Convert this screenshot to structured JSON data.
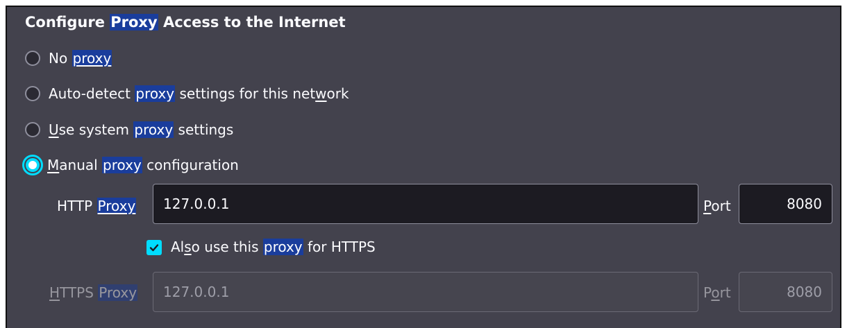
{
  "section": {
    "title_pre": "Configure ",
    "title_hl": "Proxy",
    "title_post": " Access to the Internet"
  },
  "options": [
    {
      "pre": "No ",
      "hl": "proxy",
      "post": ""
    },
    {
      "pre": "Auto-detect ",
      "hl": "proxy",
      "post": " settings for this net",
      "u": "w",
      "post2": "ork"
    },
    {
      "u": "U",
      "pre": "se system ",
      "hl": "proxy",
      "post": " settings"
    },
    {
      "u": "M",
      "pre": "anual ",
      "hl": "proxy",
      "post": " configuration"
    }
  ],
  "http": {
    "label_pre": "HTTP ",
    "label_hl": "Proxy",
    "value": "127.0.0.1",
    "port_label_u": "P",
    "port_label_rest": "ort",
    "port": "8080"
  },
  "also_https": {
    "pre": "Al",
    "u": "s",
    "mid": "o use this ",
    "hl": "proxy",
    "post": " for HTTPS",
    "checked": true
  },
  "https": {
    "label_u": "H",
    "label_pre": "TTPS ",
    "label_hl": "Proxy",
    "value": "127.0.0.1",
    "port_label_pre": "P",
    "port_label_u": "o",
    "port_label_rest": "rt",
    "port": "8080"
  },
  "colors": {
    "panel": "#43424d",
    "highlight": "#1a3d9c",
    "accent": "#00ddff"
  }
}
